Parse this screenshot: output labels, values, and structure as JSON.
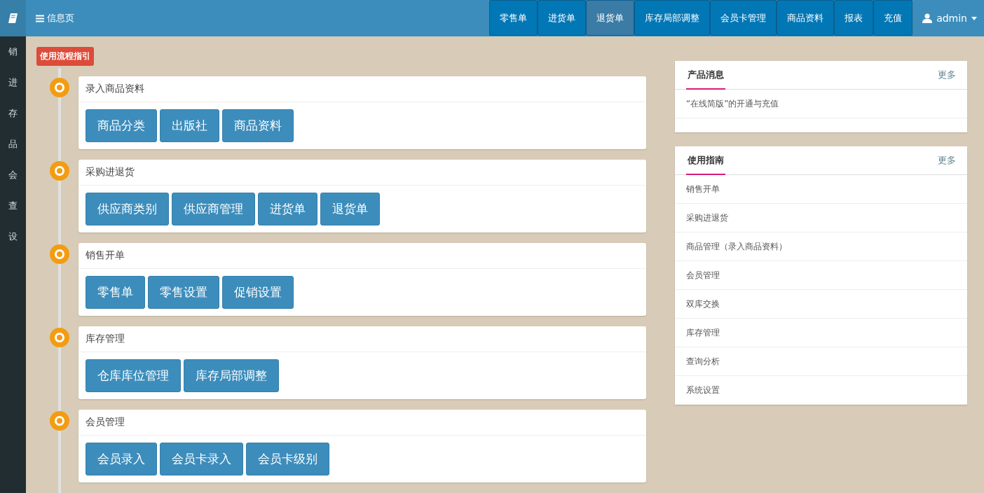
{
  "sidebar": {
    "items": [
      {
        "label": "销"
      },
      {
        "label": "进"
      },
      {
        "label": "存"
      },
      {
        "label": "品"
      },
      {
        "label": "会"
      },
      {
        "label": "查"
      },
      {
        "label": "设"
      }
    ]
  },
  "header": {
    "title": "信息页",
    "nav": [
      {
        "label": "零售单",
        "selected": false
      },
      {
        "label": "进货单",
        "selected": false
      },
      {
        "label": "退货单",
        "selected": true
      },
      {
        "label": "库存局部调整",
        "selected": false
      },
      {
        "label": "会员卡管理",
        "selected": false
      },
      {
        "label": "商品资料",
        "selected": false
      },
      {
        "label": "报表",
        "selected": false
      },
      {
        "label": "充值",
        "selected": false
      }
    ],
    "user": "admin"
  },
  "guide": {
    "badge": "使用流程指引",
    "steps": [
      {
        "title": "录入商品资料",
        "buttons": [
          "商品分类",
          "出版社",
          "商品资料"
        ]
      },
      {
        "title": "采购进退货",
        "buttons": [
          "供应商类别",
          "供应商管理",
          "进货单",
          "退货单"
        ]
      },
      {
        "title": "销售开单",
        "buttons": [
          "零售单",
          "零售设置",
          "促销设置"
        ]
      },
      {
        "title": "库存管理",
        "buttons": [
          "仓库库位管理",
          "库存局部调整"
        ]
      },
      {
        "title": "会员管理",
        "buttons": [
          "会员录入",
          "会员卡录入",
          "会员卡级别"
        ]
      }
    ]
  },
  "panels": [
    {
      "title": "产品消息",
      "more": "更多",
      "items": [
        "“在线简版”的开通与充值"
      ]
    },
    {
      "title": "使用指南",
      "more": "更多",
      "items": [
        "销售开单",
        "采购进退货",
        "商品管理（录入商品资料）",
        "会员管理",
        "双库交换",
        "库存管理",
        "查询分析",
        "系统设置"
      ]
    }
  ]
}
